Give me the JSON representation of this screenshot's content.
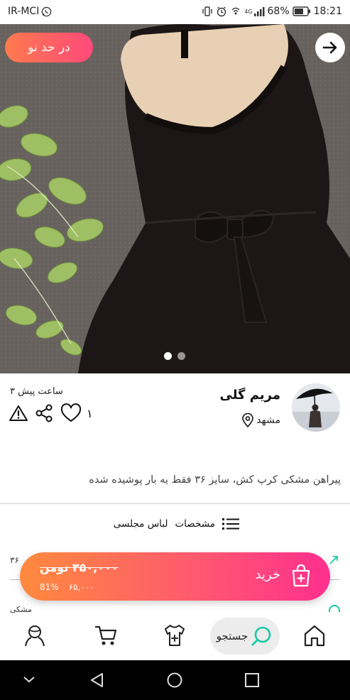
{
  "status_bar": {
    "carrier": "IR-MCI",
    "battery": "68%",
    "time": "18:21",
    "signal": "4G"
  },
  "hero": {
    "badge": "در حد نو",
    "slide_count": 2,
    "active_slide": 1
  },
  "seller": {
    "name": "مریم گلی",
    "city": "مشهد",
    "time_ago": "۳ ساعت پیش",
    "likes": "۱"
  },
  "description": "پیراهن مشکی کرپ کش، سایز ۳۶ فقط یه بار پوشیده شده",
  "specs": {
    "title": "مشخصات",
    "category": "لباس مجلسی",
    "peek_size": "۳۶",
    "peek_color": "مشکی"
  },
  "buy": {
    "label": "خرید",
    "price": "۳۵۰,۰۰۰ تومن",
    "discount_percent": "81%",
    "final_price": "۶۵,۰۰۰"
  },
  "nav": {
    "search_label": "جستجو"
  },
  "colors": {
    "accent_green": "#1ac9a2",
    "buy_gradient_start": "#ff8a3d",
    "buy_gradient_end": "#ff2f8e"
  },
  "icons": [
    "whatsapp-icon",
    "vibrate-icon",
    "alarm-icon",
    "signal-icon",
    "battery-icon",
    "arrow-right-icon",
    "location-pin-icon",
    "report-icon",
    "share-icon",
    "heart-icon",
    "list-icon",
    "expand-icon",
    "shopping-bag-add-icon",
    "profile-icon",
    "cart-icon",
    "add-clothes-icon",
    "search-icon",
    "home-icon",
    "back-triangle-icon",
    "home-circle-icon",
    "recents-square-icon",
    "chevron-down-icon"
  ]
}
